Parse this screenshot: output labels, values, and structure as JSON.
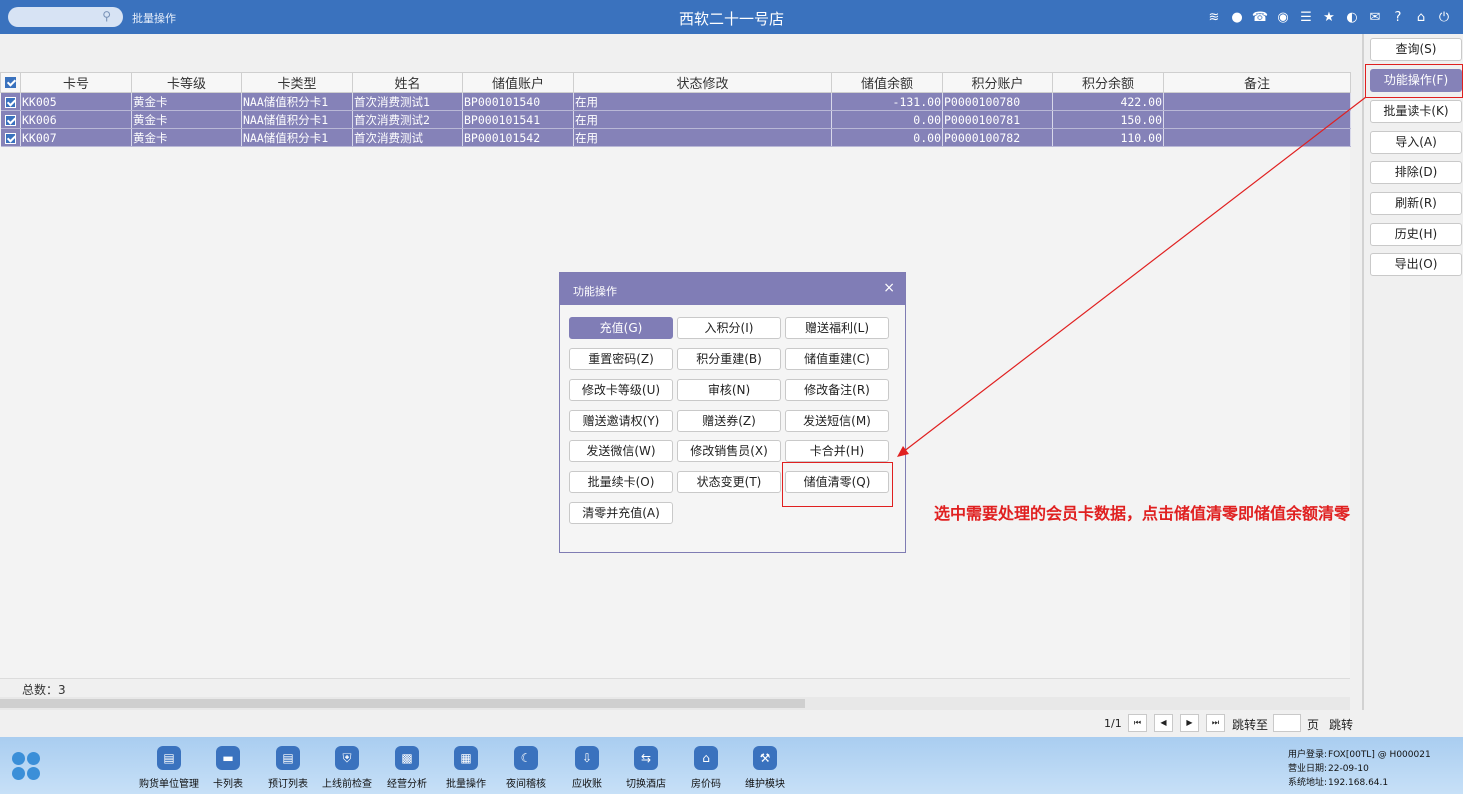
{
  "topbar": {
    "subtitle": "批量操作",
    "title": "西软二十一号店",
    "icons": [
      "wifi-icon",
      "message-icon",
      "phone-icon",
      "palette-icon",
      "menu-icon",
      "star-icon",
      "moon-icon",
      "mail-icon",
      "help-icon",
      "home-icon",
      "power-icon"
    ]
  },
  "grid": {
    "headers": [
      "卡号",
      "卡等级",
      "卡类型",
      "姓名",
      "储值账户",
      "状态修改",
      "储值余额",
      "积分账户",
      "积分余额",
      "备注"
    ],
    "rows": [
      [
        "KK005",
        "黄金卡",
        "NAA储值积分卡1",
        "首次消费测试1",
        "BP000101540",
        "在用",
        "-131.00",
        "P0000100780",
        "422.00",
        ""
      ],
      [
        "KK006",
        "黄金卡",
        "NAA储值积分卡1",
        "首次消费测试2",
        "BP000101541",
        "在用",
        "0.00",
        "P0000100781",
        "150.00",
        ""
      ],
      [
        "KK007",
        "黄金卡",
        "NAA储值积分卡1",
        "首次消费测试",
        "BP000101542",
        "在用",
        "0.00",
        "P0000100782",
        "110.00",
        ""
      ]
    ],
    "total_label": "总数：3"
  },
  "pager": {
    "page_info": "1/1",
    "first": "⏮",
    "prev": "◀",
    "next": "▶",
    "last": "⏭",
    "jump_label": "跳转至",
    "page_unit": "页",
    "jump_button": "跳转"
  },
  "side_buttons": [
    "查询(S)",
    "功能操作(F)",
    "批量读卡(K)",
    "导入(A)",
    "排除(D)",
    "刷新(R)",
    "历史(H)",
    "导出(O)"
  ],
  "dialog": {
    "title": "功能操作",
    "close": "×",
    "buttons": [
      "充值(G)",
      "入积分(I)",
      "赠送福利(L)",
      "重置密码(Z)",
      "积分重建(B)",
      "储值重建(C)",
      "修改卡等级(U)",
      "审核(N)",
      "修改备注(R)",
      "赠送邀请权(Y)",
      "赠送券(Z)",
      "发送短信(M)",
      "发送微信(W)",
      "修改销售员(X)",
      "卡合并(H)",
      "批量续卡(O)",
      "状态变更(T)",
      "储值清零(Q)",
      "清零并充值(A)"
    ]
  },
  "annotation": "选中需要处理的会员卡数据，点击储值清零即储值余额清零",
  "dock": {
    "items": [
      {
        "label": "购货单位管理",
        "icon": "building-icon"
      },
      {
        "label": "卡列表",
        "icon": "card-icon"
      },
      {
        "label": "预订列表",
        "icon": "booking-icon"
      },
      {
        "label": "上线前检查",
        "icon": "shield-icon"
      },
      {
        "label": "经营分析",
        "icon": "bar-chart-icon"
      },
      {
        "label": "批量操作",
        "icon": "batch-icon"
      },
      {
        "label": "夜间稽核",
        "icon": "moon-icon"
      },
      {
        "label": "应收账",
        "icon": "download-icon"
      },
      {
        "label": "切换酒店",
        "icon": "switch-icon"
      },
      {
        "label": "房价码",
        "icon": "house-icon"
      },
      {
        "label": "维护模块",
        "icon": "wrench-icon"
      }
    ]
  },
  "info": {
    "user_label": "用户登录:",
    "user_value": "FOX[00TL] @ H000021",
    "date_label": "营业日期:",
    "date_value": "22-09-10",
    "addr_label": "系统地址:",
    "addr_value": "192.168.64.1"
  }
}
